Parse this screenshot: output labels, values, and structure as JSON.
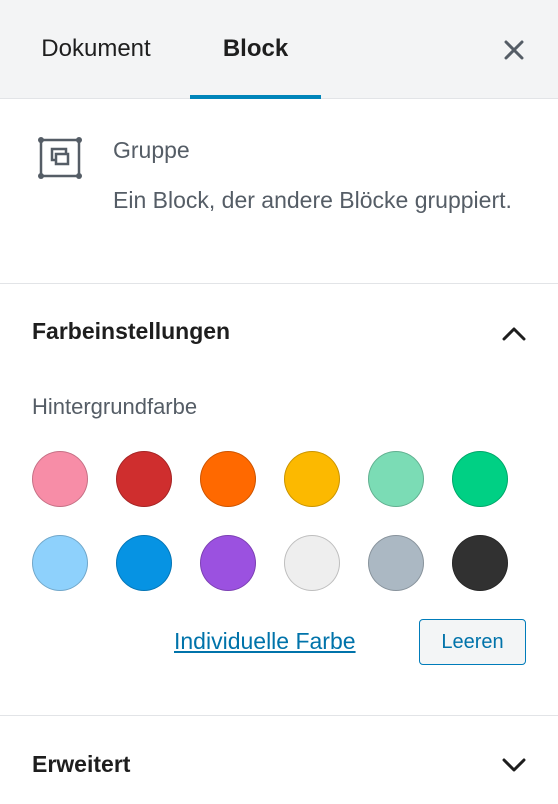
{
  "tabs": {
    "document": "Dokument",
    "block": "Block"
  },
  "block_card": {
    "title": "Gruppe",
    "description": "Ein Block, der andere Blöcke gruppiert."
  },
  "color_panel": {
    "title": "Farbeinstellungen",
    "background_label": "Hintergrundfarbe",
    "swatches": [
      {
        "name": "pale-pink",
        "color": "#f78da7"
      },
      {
        "name": "vivid-red",
        "color": "#cf2e2e"
      },
      {
        "name": "luminous-vivid-orange",
        "color": "#ff6900"
      },
      {
        "name": "luminous-vivid-amber",
        "color": "#fcb900"
      },
      {
        "name": "light-green-cyan",
        "color": "#7bdcb5"
      },
      {
        "name": "vivid-green-cyan",
        "color": "#00d084"
      },
      {
        "name": "pale-cyan-blue",
        "color": "#8ed1fc"
      },
      {
        "name": "vivid-cyan-blue",
        "color": "#0693e3"
      },
      {
        "name": "vivid-purple",
        "color": "#9b51e0"
      },
      {
        "name": "very-light-gray",
        "color": "#eeeeee"
      },
      {
        "name": "cyan-bluish-gray",
        "color": "#abb8c3"
      },
      {
        "name": "very-dark-gray",
        "color": "#313131"
      }
    ],
    "custom_color": "Individuelle Farbe",
    "clear": "Leeren"
  },
  "advanced_panel": {
    "title": "Erweitert"
  }
}
